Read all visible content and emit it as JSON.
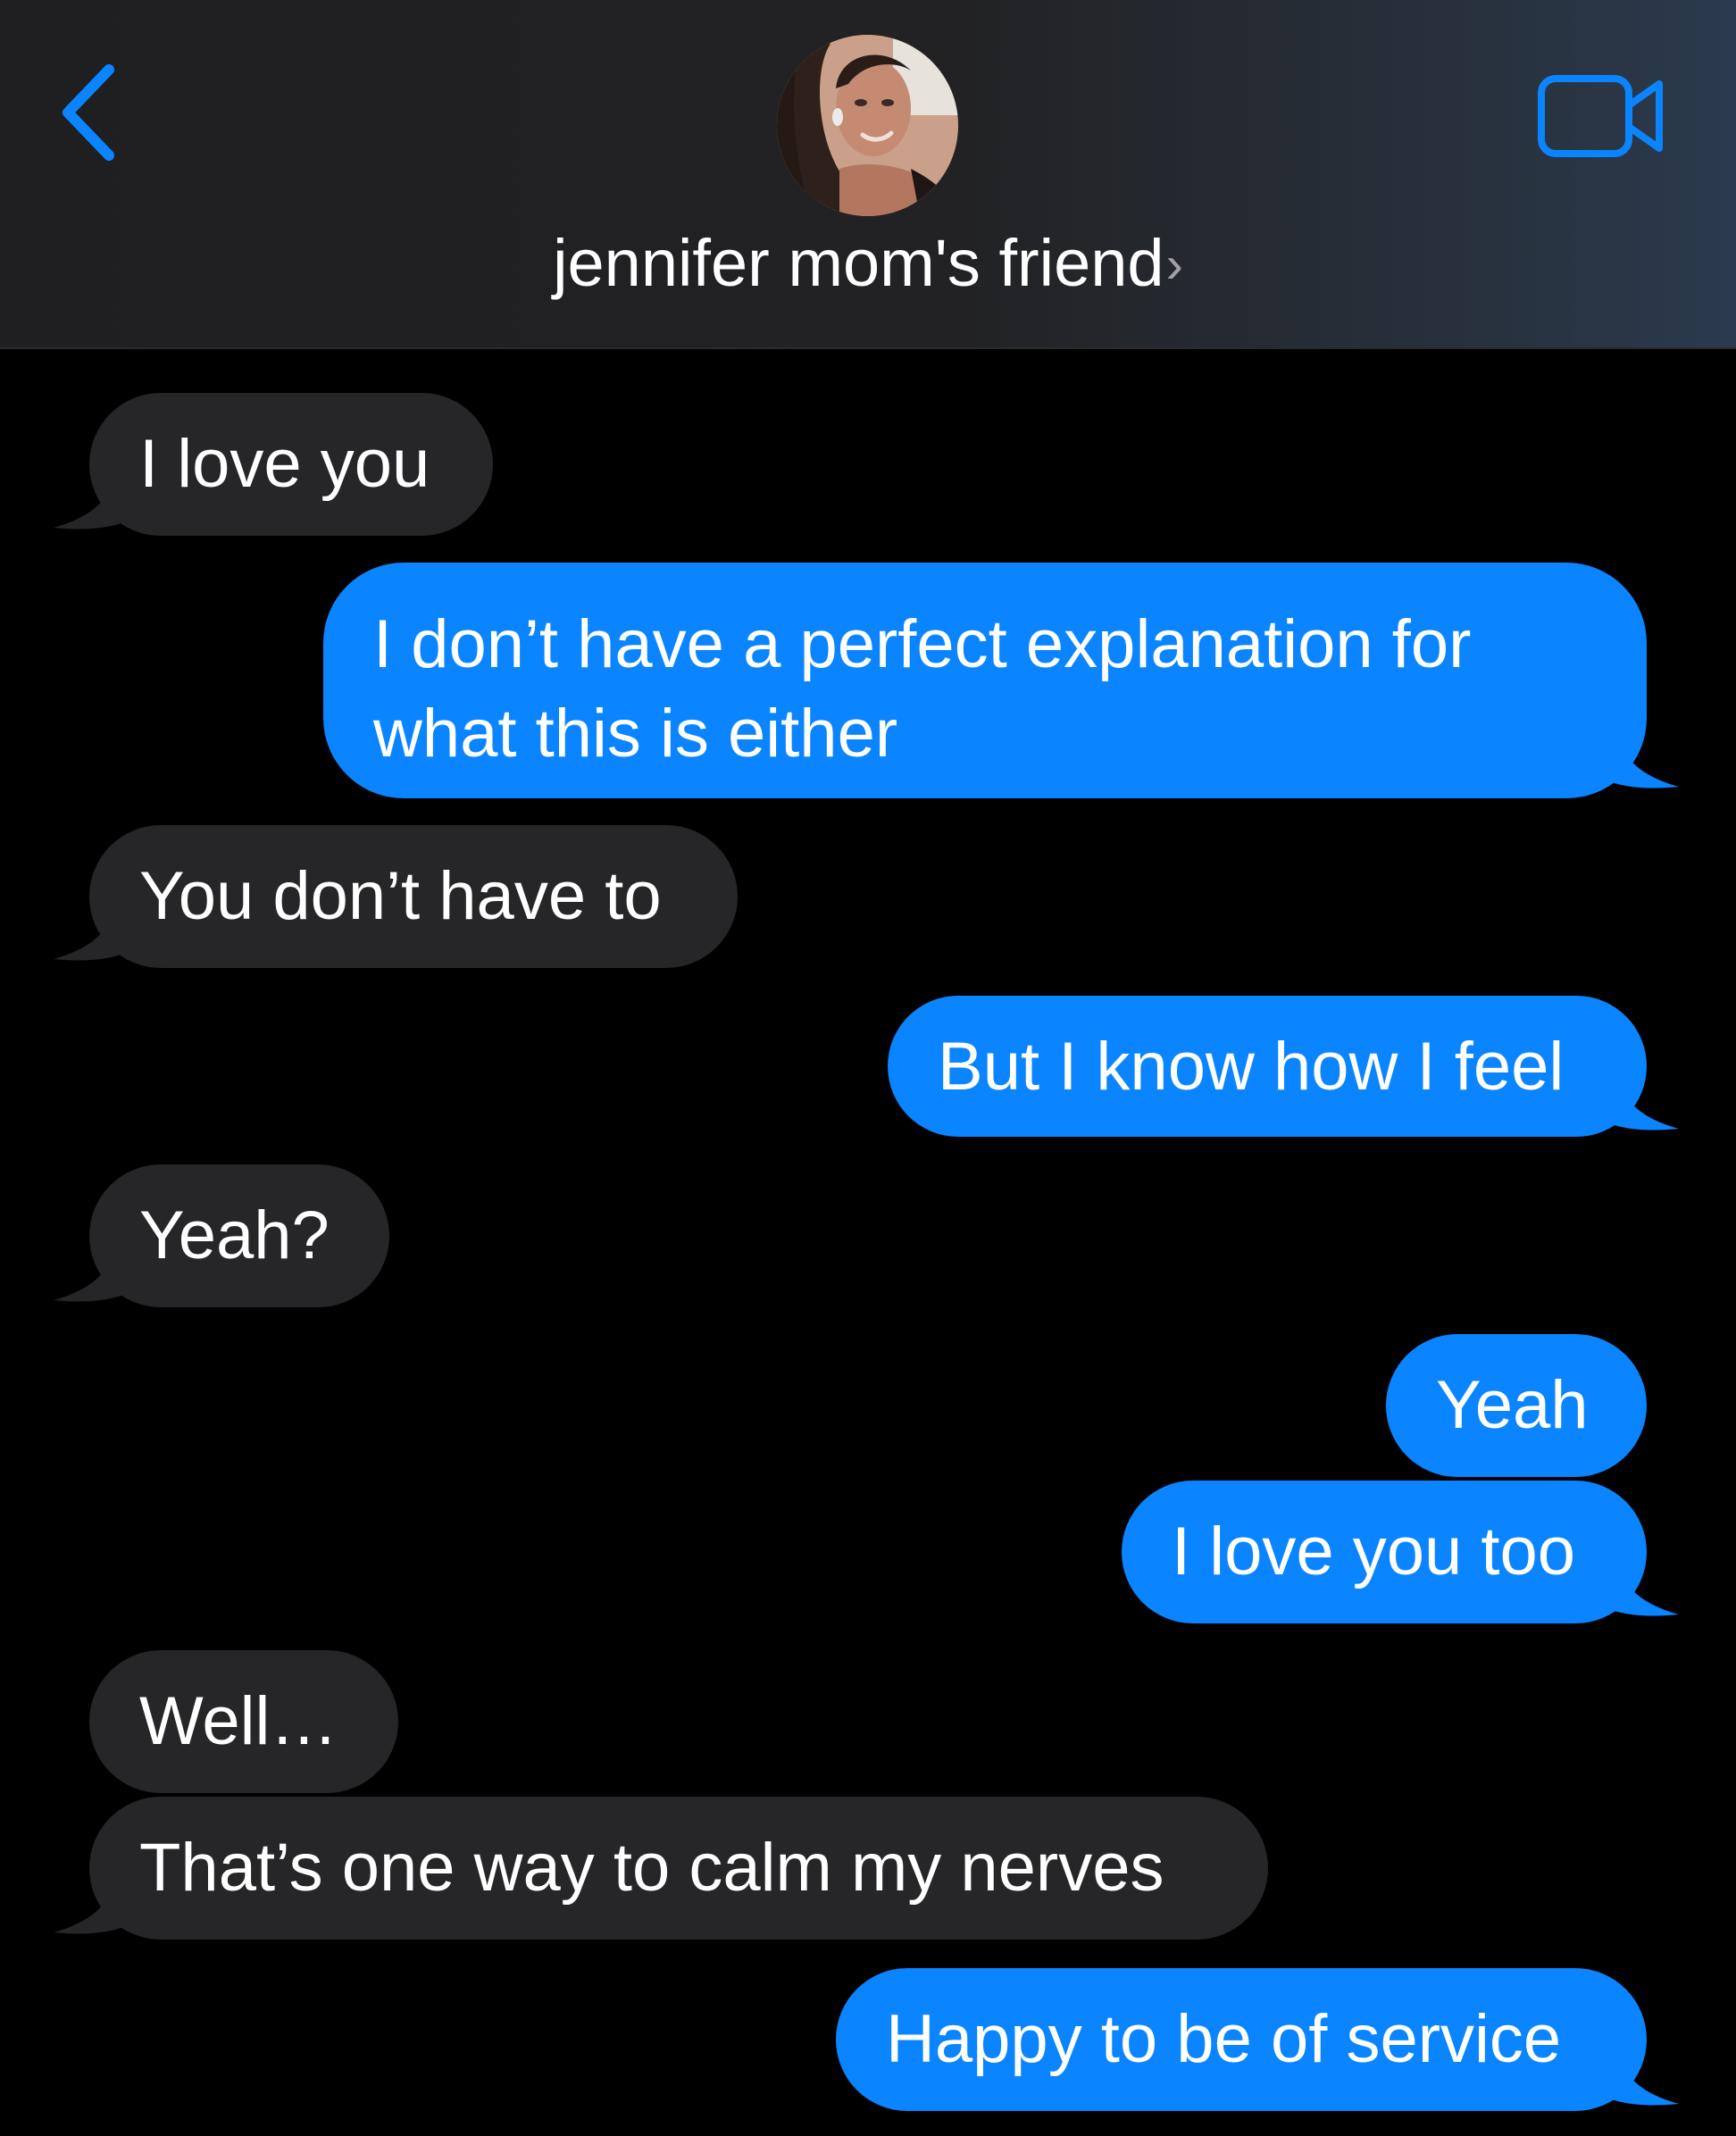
{
  "header": {
    "contact_name": "jennifer mom's friend",
    "chevron": "›",
    "back_icon": "chevron-left-icon",
    "video_icon": "video-camera-icon",
    "accent_color": "#0a84ff"
  },
  "messages": [
    {
      "from": "them",
      "text": "I love you"
    },
    {
      "from": "me",
      "text": "I don’t have a perfect explanation for what this is either"
    },
    {
      "from": "them",
      "text": "You don’t have to"
    },
    {
      "from": "me",
      "text": "But I know how I feel"
    },
    {
      "from": "them",
      "text": "Yeah?"
    },
    {
      "from": "me",
      "text": "Yeah"
    },
    {
      "from": "me",
      "text": "I love you too"
    },
    {
      "from": "them",
      "text": "Well…"
    },
    {
      "from": "them",
      "text": "That’s one way to calm my nerves"
    },
    {
      "from": "me",
      "text": "Happy to be of service"
    }
  ],
  "colors": {
    "incoming_bubble": "#262628",
    "outgoing_bubble": "#0a84ff",
    "background": "#000000"
  }
}
